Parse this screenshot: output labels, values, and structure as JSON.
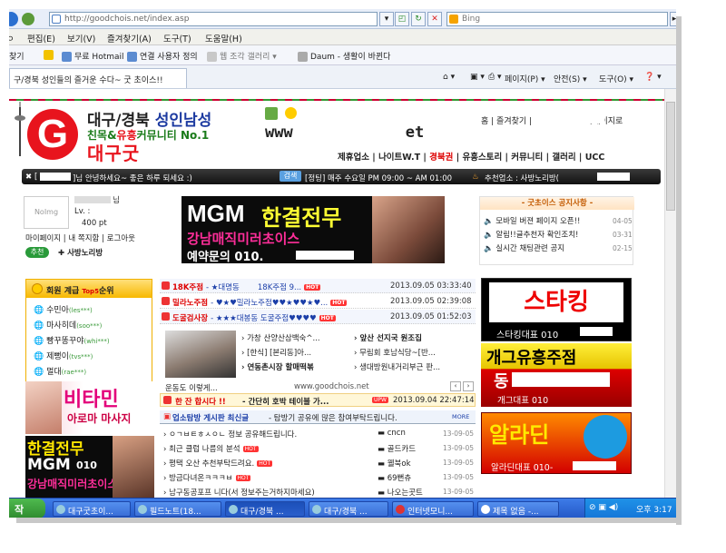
{
  "browser": {
    "url": "http://goodchois.net/index.asp",
    "search_placeholder": "Bing"
  },
  "menu": [
    "편집(E)",
    "보기(V)",
    "즐겨찾기(A)",
    "도구(T)",
    "도움말(H)"
  ],
  "menu_left_fragment": "ㅇ",
  "favorites": {
    "fragment": "찾기",
    "items": [
      "무료 Hotmail",
      "연결 사용자 정의",
      "웹 조각 갤러리 ▾",
      "Daum - 생활이 바뀐다"
    ]
  },
  "tab": {
    "label": "구/경북 성인들의 즐거운 수다~ 굿 초이스!!"
  },
  "commands": [
    "페이지(P) ▾",
    "안전(S) ▾",
    "도구(O) ▾"
  ],
  "site": {
    "logo_letter": "G",
    "logo_line1_a": "대구/경북 ",
    "logo_line1_b": "성인남성",
    "logo_line2_a": "친목&",
    "logo_line2_b": "유흥",
    "logo_line2_c": "커뮤니티 No.1",
    "logo_line3": "대구굿",
    "www_a": "www",
    "www_b": "et",
    "top_links": "홈 | 즐겨찾기 | ",
    "top_links_tail": "자페이지로",
    "main_nav": [
      "제휴업소",
      "나이트W.T",
      "경북권",
      "유흥스토리",
      "커뮤니티",
      "갤러리",
      "UCC"
    ],
    "greeting_prefix": "[",
    "greeting": "]님 안녕하세요~ 좋은 하루 되세요 :)",
    "search_btn": "검색",
    "notice_bar": "[정팅] 매주 수요일 PM 09:00 ~ AM 01:00",
    "recommend": "추천업소 : 사방노리방("
  },
  "profile": {
    "noimg": "NoImg",
    "name_suffix": "님",
    "level": "Lv. :",
    "points": "400 pt",
    "links": "마이페이지 | 내 쪽지함 | 로그아웃",
    "recommend_label": "추천",
    "recommend_value": "사방노리방"
  },
  "banner_center": {
    "title": "MGM",
    "highlight": "한결전무",
    "subtitle": "강남매직미러초이스",
    "phone_prefix": "예약문의 010."
  },
  "notice_box": {
    "title": "굿초이스 공지사항",
    "items": [
      {
        "text": "모바일 버젼 페이지 오픈!!",
        "date": "04-05"
      },
      {
        "text": "알림!!글추천자 확인조치!",
        "date": "03-31"
      },
      {
        "text": "실시간 채팅관련 공지",
        "date": "02-15"
      }
    ]
  },
  "rank": {
    "title": "회원 계급",
    "title_top": "Top5",
    "title_tail": "순위",
    "members": [
      {
        "name": "수민아",
        "id": "(les***)"
      },
      {
        "name": "마사히데",
        "id": "(soo***)"
      },
      {
        "name": "빵꾸똥꾸야",
        "id": "(whi***)"
      },
      {
        "name": "제뻥이",
        "id": "(tvs***)"
      },
      {
        "name": "멀대",
        "id": "(rae***)"
      }
    ]
  },
  "feed": [
    {
      "tag": "18K주점",
      "text": "- ★대명동",
      "text2": "18K주점 9...",
      "date": "2013.09.05  03:33:40"
    },
    {
      "tag": "밀라노주점",
      "text": "- ♥★♥밀라노주점♥♥★♥♥★♥...",
      "text2": "",
      "date": "2013.09.05  02:39:08"
    },
    {
      "tag": "도굴검사장",
      "text": "- ★★★대봉동 도굴주점♥♥♥♥",
      "text2": "",
      "date": "2013.09.05  01:52:03"
    }
  ],
  "thumbs": {
    "caption": "운동도 이렇게...",
    "site": "www.goodchois.net",
    "col1": [
      "가창 산양산삼백숙^...",
      "[한식] [본리동]아...",
      "연동촌시장 할매떡볶"
    ],
    "col2": [
      "앞산 선지국 원조집",
      "무림회 호남식당~[반...",
      "생대방원내거리부근 판..."
    ]
  },
  "jan": {
    "tag": "한 잔 합시다 !!",
    "text": "- 간단히 호박 테이블 가...",
    "date": "2013.09.04  22:47:14"
  },
  "board": {
    "head_title": "업소탐방 게시판 최신글",
    "head_text": "- 탐방기 공유에 많은 참여부탁드립니다.",
    "more": "MORE",
    "left": [
      "ㅇㄱㅂㅌㅎㅅㅇㄴ 정보 공유해드립니다.",
      "최근 클럽 나름의 분석",
      "평택 오산 추천부탁드려요.",
      "방금다녀온ㅋㅋㅋㅂ",
      "남구동공포프 니다(서 정보주는거하지마세요)"
    ],
    "right": [
      "cncn",
      "골드카드",
      "웰북ok",
      "69뻔츄",
      "나오는곳트"
    ],
    "dates": [
      "13-09-05",
      "13-09-05",
      "13-09-05",
      "13-09-05",
      "13-09-05"
    ]
  },
  "left_ads": {
    "vitamin": "비타민",
    "vitamin_sub": "아로마 마사지",
    "mgm2_top": "한결전무",
    "mgm2_mgm": "MGM",
    "mgm2_num": "010",
    "mgm2_sub": "강남매직미러초이스"
  },
  "right_ads": {
    "stk": "스타킹",
    "stk_caption": "스타킹대표 010",
    "gag": "개그유흥주점",
    "gag_sub": "동",
    "gag_caption": "개그대표  010",
    "aladdin": "알라딘",
    "aladdin_caption": "알라딘대표  010-"
  },
  "taskbar": {
    "start": "작",
    "tasks": [
      "대구굿초이...",
      "필드노트(18...",
      "대구/경북 ...",
      "대구/경북 ...",
      "인터넷모니...",
      "제목 없음 -..."
    ],
    "clock": "오후 3:17"
  }
}
